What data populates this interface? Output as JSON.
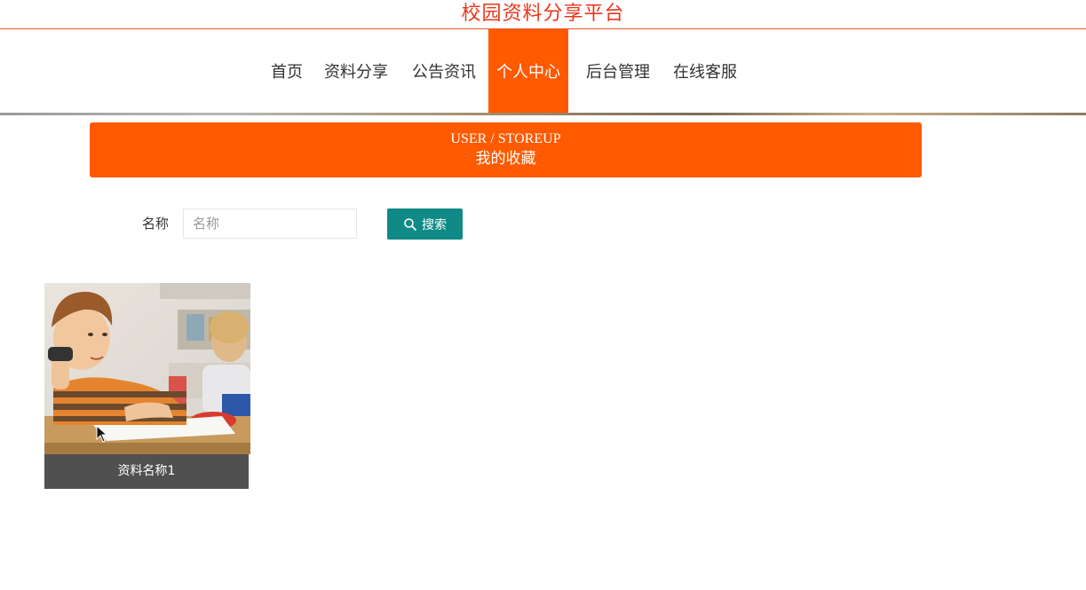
{
  "site": {
    "title": "校园资料分享平台"
  },
  "nav": {
    "items": [
      {
        "label": "首页",
        "active": false
      },
      {
        "label": "资料分享",
        "active": false
      },
      {
        "label": "公告资讯",
        "active": false
      },
      {
        "label": "个人中心",
        "active": true
      },
      {
        "label": "后台管理",
        "active": false
      },
      {
        "label": "在线客服",
        "active": false
      }
    ]
  },
  "banner": {
    "en": "USER / STOREUP",
    "cn": "我的收藏"
  },
  "search": {
    "label": "名称",
    "placeholder": "名称",
    "value": "",
    "button_label": "搜索"
  },
  "cards": [
    {
      "name": "资料名称1"
    }
  ],
  "colors": {
    "accent": "#ff5a00",
    "title": "#e8381d",
    "search_button": "#0f8a87",
    "caption_bg": "#505050"
  }
}
